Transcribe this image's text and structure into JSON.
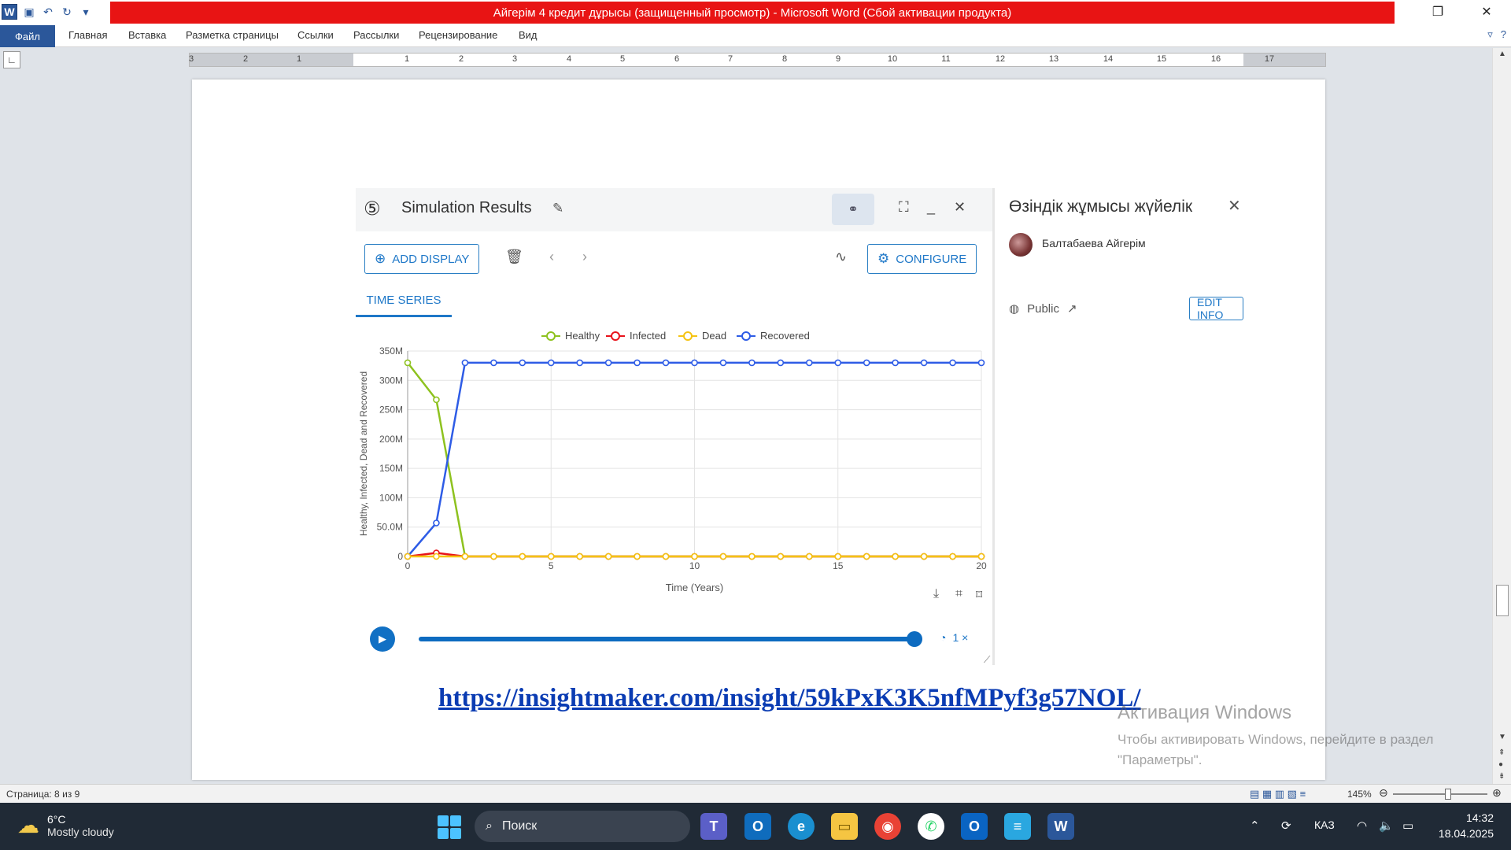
{
  "window": {
    "title": "Айгерім 4 кредит дұрысы (защищенный просмотр) - Microsoft Word (Сбой активации продукта)"
  },
  "ribbon": {
    "file": "Файл",
    "tabs": [
      "Главная",
      "Вставка",
      "Разметка страницы",
      "Ссылки",
      "Рассылки",
      "Рецензирование",
      "Вид"
    ]
  },
  "ruler": {
    "ticks": [
      "3",
      "2",
      "1",
      "1",
      "2",
      "3",
      "4",
      "5",
      "6",
      "7",
      "8",
      "9",
      "10",
      "11",
      "12",
      "13",
      "14",
      "15",
      "16",
      "17"
    ]
  },
  "sim": {
    "step": "⑤",
    "title": "Simulation Results",
    "add_display": "ADD DISPLAY",
    "configure": "CONFIGURE",
    "tab": "TIME SERIES",
    "speed": "1 ×"
  },
  "chart_data": {
    "type": "line",
    "xlabel": "Time (Years)",
    "ylabel": "Healthy, Infected, Dead and Recovered",
    "xlim": [
      0,
      20
    ],
    "ylim": [
      0,
      350000000
    ],
    "x_ticks": [
      "0",
      "5",
      "10",
      "15",
      "20"
    ],
    "y_ticks": [
      "0",
      "50.0M",
      "100M",
      "150M",
      "200M",
      "250M",
      "300M",
      "350M"
    ],
    "grid": true,
    "legend": "top",
    "x": [
      0,
      1,
      2,
      3,
      4,
      5,
      6,
      7,
      8,
      9,
      10,
      11,
      12,
      13,
      14,
      15,
      16,
      17,
      18,
      19,
      20
    ],
    "series": [
      {
        "name": "Healthy",
        "color": "#8ec21f",
        "values": [
          330000000,
          267000000,
          0,
          0,
          0,
          0,
          0,
          0,
          0,
          0,
          0,
          0,
          0,
          0,
          0,
          0,
          0,
          0,
          0,
          0,
          0
        ]
      },
      {
        "name": "Infected",
        "color": "#e8131b",
        "values": [
          0,
          6000000,
          0,
          0,
          0,
          0,
          0,
          0,
          0,
          0,
          0,
          0,
          0,
          0,
          0,
          0,
          0,
          0,
          0,
          0,
          0
        ]
      },
      {
        "name": "Dead",
        "color": "#f5c313",
        "values": [
          0,
          0,
          0,
          0,
          0,
          0,
          0,
          0,
          0,
          0,
          0,
          0,
          0,
          0,
          0,
          0,
          0,
          0,
          0,
          0,
          0
        ]
      },
      {
        "name": "Recovered",
        "color": "#2e5ce6",
        "values": [
          0,
          57000000,
          330000000,
          330000000,
          330000000,
          330000000,
          330000000,
          330000000,
          330000000,
          330000000,
          330000000,
          330000000,
          330000000,
          330000000,
          330000000,
          330000000,
          330000000,
          330000000,
          330000000,
          330000000,
          330000000
        ]
      }
    ]
  },
  "info": {
    "title": "Өзіндік жұмысы жүйелік",
    "author": "Балтабаева Айгерім",
    "visibility": "Public",
    "edit": "EDIT INFO"
  },
  "link": "https://insightmaker.com/insight/59kPxK3K5nfMPyf3g57NOL/",
  "activation": {
    "line1": "Активация Windows",
    "line2": "Чтобы активировать Windows, перейдите в раздел",
    "line3": "\"Параметры\"."
  },
  "status": {
    "page": "Страница: 8 из 9",
    "zoom": "145%"
  },
  "taskbar": {
    "temp": "6°C",
    "weather": "Mostly cloudy",
    "search": "Поиск",
    "lang": "КАЗ",
    "time": "14:32",
    "date": "18.04.2025"
  }
}
